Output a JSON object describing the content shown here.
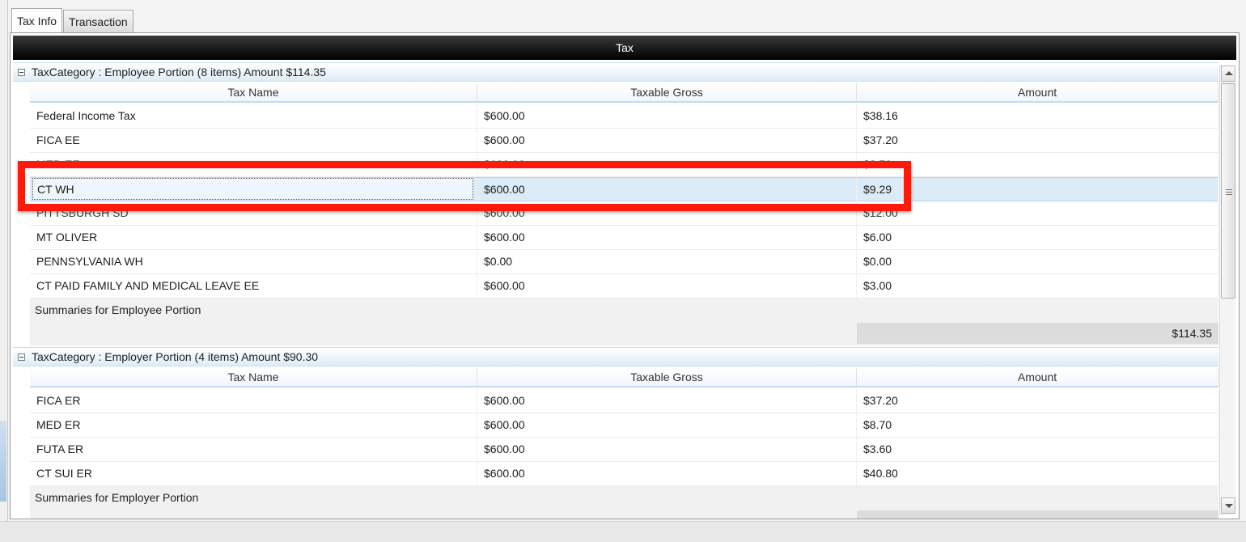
{
  "tabs": [
    {
      "label": "Tax Info"
    },
    {
      "label": "Transaction"
    }
  ],
  "grid": {
    "title": "Tax",
    "columns": {
      "name": "Tax Name",
      "gross": "Taxable Gross",
      "amount": "Amount"
    },
    "groups": [
      {
        "label": "TaxCategory : Employee Portion (8 items) Amount $114.35",
        "rows": [
          {
            "name": "Federal Income Tax",
            "gross": "$600.00",
            "amount": "$38.16"
          },
          {
            "name": "FICA EE",
            "gross": "$600.00",
            "amount": "$37.20"
          },
          {
            "name": "MED EE",
            "gross": "$600.00",
            "amount": "$8.70"
          },
          {
            "name": "CT WH",
            "gross": "$600.00",
            "amount": "$9.29"
          },
          {
            "name": "PITTSBURGH SD",
            "gross": "$600.00",
            "amount": "$12.00"
          },
          {
            "name": "MT OLIVER",
            "gross": "$600.00",
            "amount": "$6.00"
          },
          {
            "name": "PENNSYLVANIA WH",
            "gross": "$0.00",
            "amount": "$0.00"
          },
          {
            "name": "CT PAID FAMILY AND MEDICAL LEAVE EE",
            "gross": "$600.00",
            "amount": "$3.00"
          }
        ],
        "summary_label": "Summaries for Employee Portion",
        "summary_total": "$114.35"
      },
      {
        "label": "TaxCategory : Employer Portion (4 items) Amount $90.30",
        "rows": [
          {
            "name": "FICA ER",
            "gross": "$600.00",
            "amount": "$37.20"
          },
          {
            "name": "MED ER",
            "gross": "$600.00",
            "amount": "$8.70"
          },
          {
            "name": "FUTA ER",
            "gross": "$600.00",
            "amount": "$3.60"
          },
          {
            "name": "CT SUI ER",
            "gross": "$600.00",
            "amount": "$40.80"
          }
        ],
        "summary_label": "Summaries for Employer Portion"
      }
    ]
  },
  "colors": {
    "highlight": "#ff1a0a",
    "header_bg": "#000000",
    "group_bg": "#ddecf8",
    "selected_row": "#dcebf8"
  }
}
